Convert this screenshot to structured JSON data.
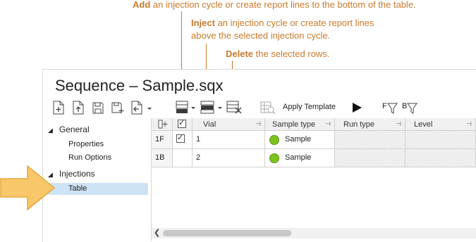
{
  "callouts": {
    "add": {
      "bold": "Add",
      "rest": " an injection cycle or create report lines to the bottom of the table."
    },
    "inject": {
      "bold": "Inject",
      "rest": " an injection cycle or create report lines",
      "line2": "above the selected injection cycle."
    },
    "delete": {
      "bold": "Delete",
      "rest": " the selected rows."
    }
  },
  "window": {
    "title": "Sequence – Sample.sqx"
  },
  "toolbar": {
    "apply_template_label": "Apply Template",
    "filter_f": "F",
    "filter_b": "B"
  },
  "tree": {
    "groups": [
      {
        "label": "General",
        "items": [
          "Properties",
          "Run Options"
        ]
      },
      {
        "label": "Injections",
        "items": [
          "Table"
        ]
      }
    ],
    "expanded_glyph": "◢",
    "selected_item": "Table"
  },
  "table": {
    "columns": [
      "Vial",
      "Sample type",
      "Run type",
      "Level"
    ],
    "rows": [
      {
        "num": "1F",
        "checked": true,
        "vial": "1",
        "sample_type": "Sample"
      },
      {
        "num": "1B",
        "checked": false,
        "vial": "2",
        "sample_type": "Sample"
      }
    ]
  },
  "colors": {
    "callout": "#c87a2c",
    "sample_dot": "#7cc11f",
    "selection": "#cfe3f7",
    "arrow": "#f7c76a"
  }
}
